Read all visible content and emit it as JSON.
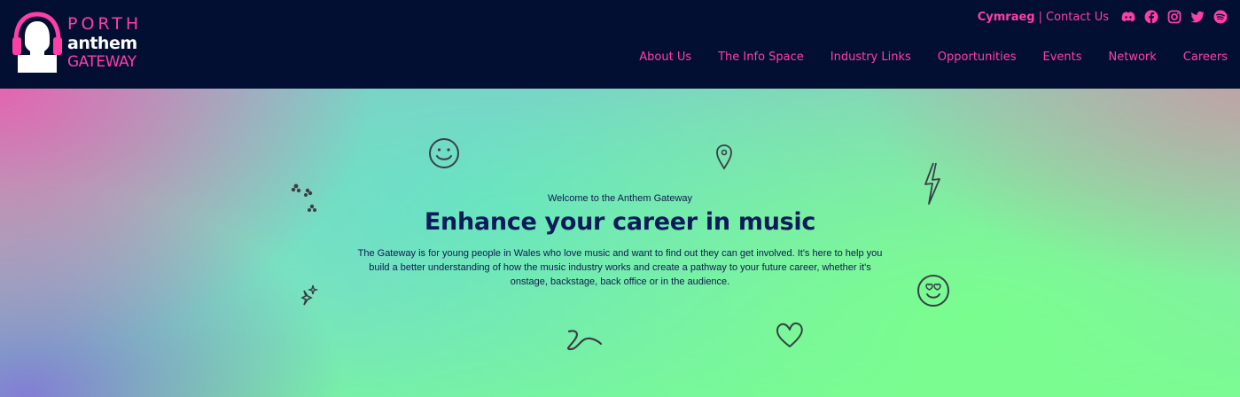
{
  "brand": {
    "line1": "PORTH",
    "line2": "anthem",
    "line3": "GATEWAY",
    "accent_color": "#ff3ea8",
    "background_color": "#020f32"
  },
  "topbar": {
    "language_label": "Cymraeg",
    "separator": "|",
    "contact_label": "Contact Us",
    "social_icons": [
      "discord-icon",
      "facebook-icon",
      "instagram-icon",
      "twitter-icon",
      "spotify-icon"
    ]
  },
  "nav": {
    "items": [
      {
        "label": "About Us"
      },
      {
        "label": "The Info Space"
      },
      {
        "label": "Industry Links"
      },
      {
        "label": "Opportunities"
      },
      {
        "label": "Events"
      },
      {
        "label": "Network"
      },
      {
        "label": "Careers"
      }
    ]
  },
  "hero": {
    "eyebrow": "Welcome to the Anthem Gateway",
    "title": "Enhance your career in music",
    "body": "The Gateway is for young people in Wales who love music and want to find out they can get involved. It's here to help you build a better understanding of how the music industry works and create a pathway to your future career, whether it's onstage, backstage, back office or in the audience.",
    "text_color": "#0b1b5a",
    "doodles": [
      "smiley-icon",
      "location-pin-icon",
      "lightning-icon",
      "flowers-icon",
      "sparkle-icon",
      "heart-eyes-smiley-icon",
      "squiggle-icon",
      "heart-icon"
    ]
  }
}
